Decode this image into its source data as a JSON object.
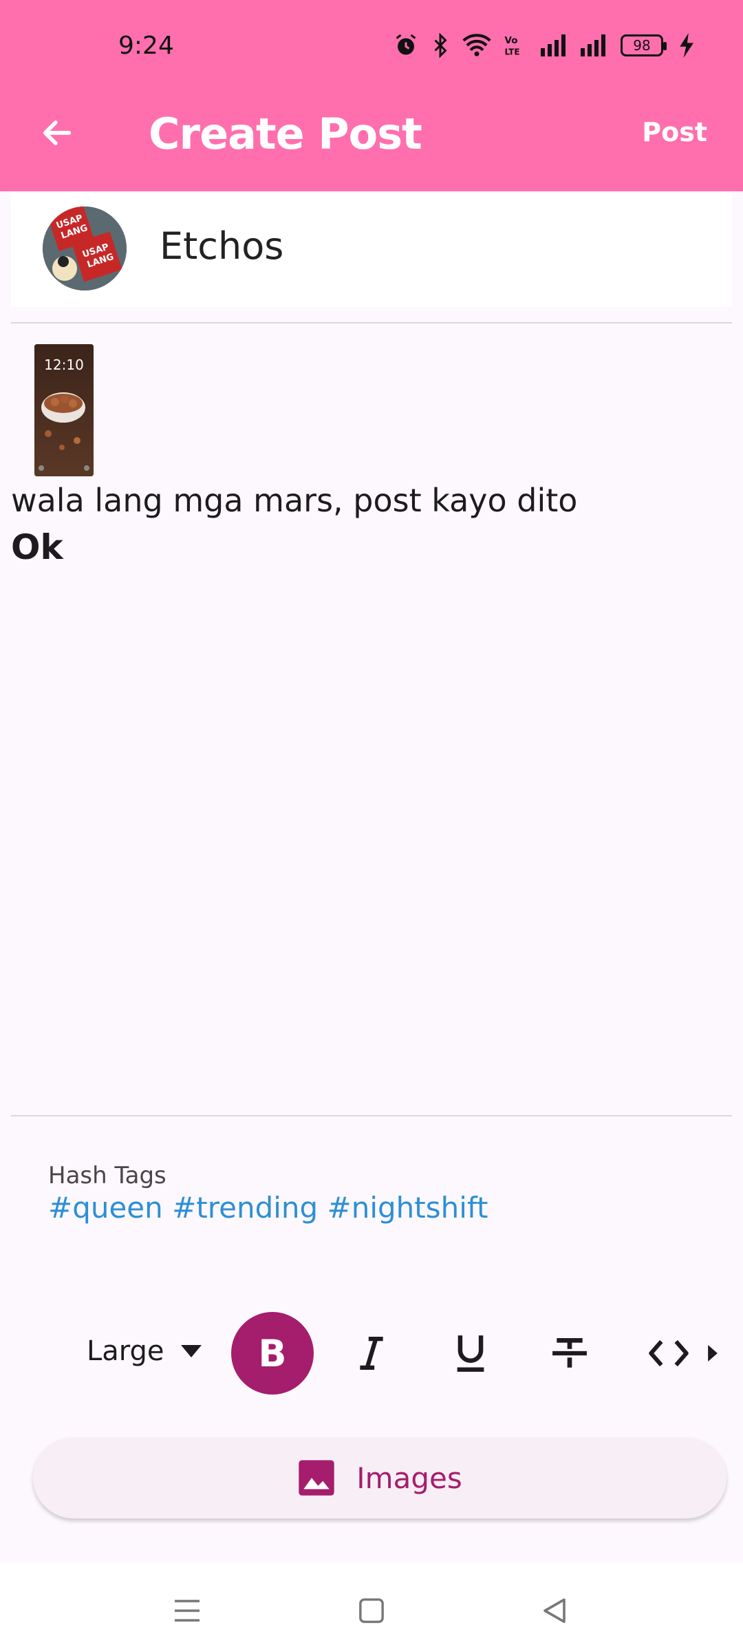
{
  "status_bar": {
    "time": "9:24",
    "battery": "98",
    "icons": [
      "alarm-icon",
      "bluetooth-icon",
      "wifi-icon",
      "volte-icon",
      "signal-icon",
      "signal-icon",
      "battery-icon",
      "charging-icon"
    ]
  },
  "app_bar": {
    "title": "Create Post",
    "post_label": "Post",
    "background": "#ff6fae"
  },
  "author": {
    "name": "Etchos",
    "avatar_text": [
      "USAP",
      "LANG",
      "USAP",
      "LANG"
    ]
  },
  "content": {
    "thumbnail_time": "12:10",
    "text": "wala lang mga mars, post kayo dito",
    "bold_text": "Ok"
  },
  "hashtags": {
    "label": "Hash Tags",
    "value": "#queen #trending #nightshift"
  },
  "toolbar": {
    "size_value": "Large",
    "bold_label": "B",
    "accent": "#a51d6d"
  },
  "images_button": {
    "label": "Images"
  },
  "nav": {
    "items": [
      "menu-icon",
      "home-icon",
      "back-icon"
    ]
  }
}
